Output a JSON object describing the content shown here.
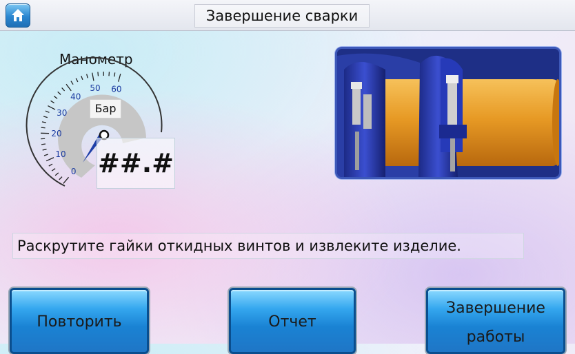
{
  "header": {
    "title": "Завершение сварки",
    "home_icon": "home-icon"
  },
  "gauge": {
    "label": "Манометр",
    "unit": "Бар",
    "value_display": "##.#",
    "ticks": [
      "0",
      "10",
      "20",
      "30",
      "40",
      "50",
      "60"
    ],
    "min": 0,
    "max": 60,
    "colors": {
      "needle": "#1f3fa8",
      "scale_fill": "#c8c8c8"
    }
  },
  "illustration": {
    "icon": "pipe-clamp-illustration"
  },
  "instruction": "Раскрутите гайки откидных винтов и извлеките изделие.",
  "buttons": {
    "repeat": "Повторить",
    "report": "Отчет",
    "finish_line1": "Завершение",
    "finish_line2": "работы"
  },
  "colors": {
    "button_blue": "#1f82d3",
    "frame_blue": "#3d58b8"
  }
}
